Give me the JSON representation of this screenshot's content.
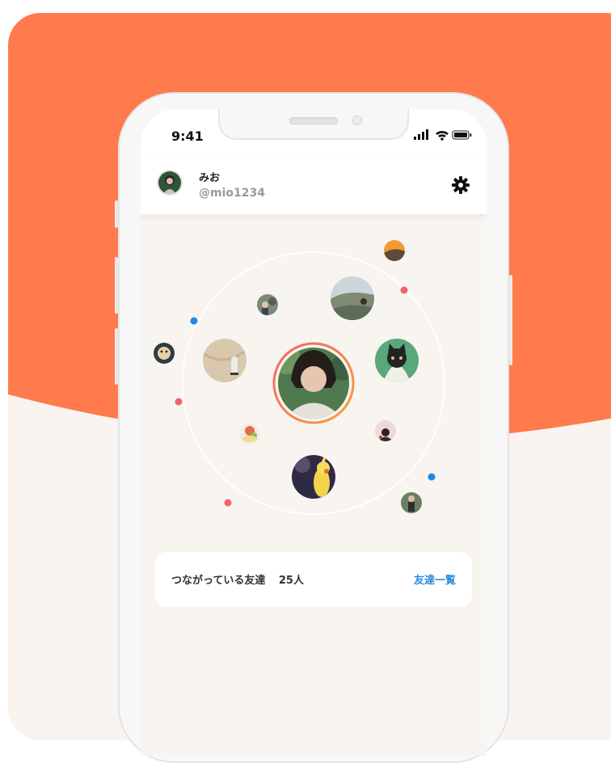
{
  "status": {
    "time": "9:41"
  },
  "profile": {
    "name": "みお",
    "handle": "@mio1234"
  },
  "icons": {
    "settings": "gear-icon",
    "signal": "cellular-signal-icon",
    "wifi": "wifi-icon",
    "battery": "battery-icon"
  },
  "friends": {
    "label": "つながっている友達",
    "count": "25人",
    "link": "友達一覧"
  },
  "colors": {
    "brand_orange": "#ff7a4d",
    "link_blue": "#2a8bde",
    "dot_red": "#f26468",
    "dot_blue": "#1e88e5"
  }
}
